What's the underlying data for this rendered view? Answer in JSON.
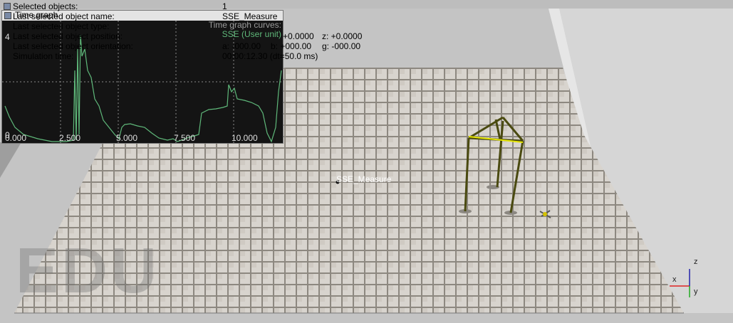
{
  "info": {
    "selected_objects_label": "Selected objects:",
    "selected_objects_value": "1",
    "last_selected_name_label": "Last selected object name:",
    "last_selected_name_value": "SSE_Measure",
    "last_selected_type_label": "Last selected object type:",
    "last_selected_position_label": "Last selected object position:",
    "position_y": "+0.0000",
    "position_z": "z: +0.0000",
    "last_selected_orientation_label": "Last selected object orientation:",
    "orientation_a": "a: -000.00",
    "orientation_b": "b: +000.00",
    "orientation_g": "g: -000.00",
    "simulation_time_label": "Simulation time:",
    "simulation_time_value": "00:00:12.30 (dt=50.0 ms)"
  },
  "graph": {
    "title": "Time graph",
    "curves_label": "Time graph curves:",
    "curve_name": "SSE (User unit)",
    "y_top_label": "4",
    "y_bottom_label": "0",
    "x_ticks": [
      "0.000",
      "2.500",
      "5.000",
      "7.500",
      "10.000"
    ],
    "line_color": "#5fb87a"
  },
  "scene": {
    "object_label": "SSE_Measure",
    "watermark": "EDU",
    "axis_x": "x",
    "axis_y": "y",
    "axis_z": "z"
  }
}
